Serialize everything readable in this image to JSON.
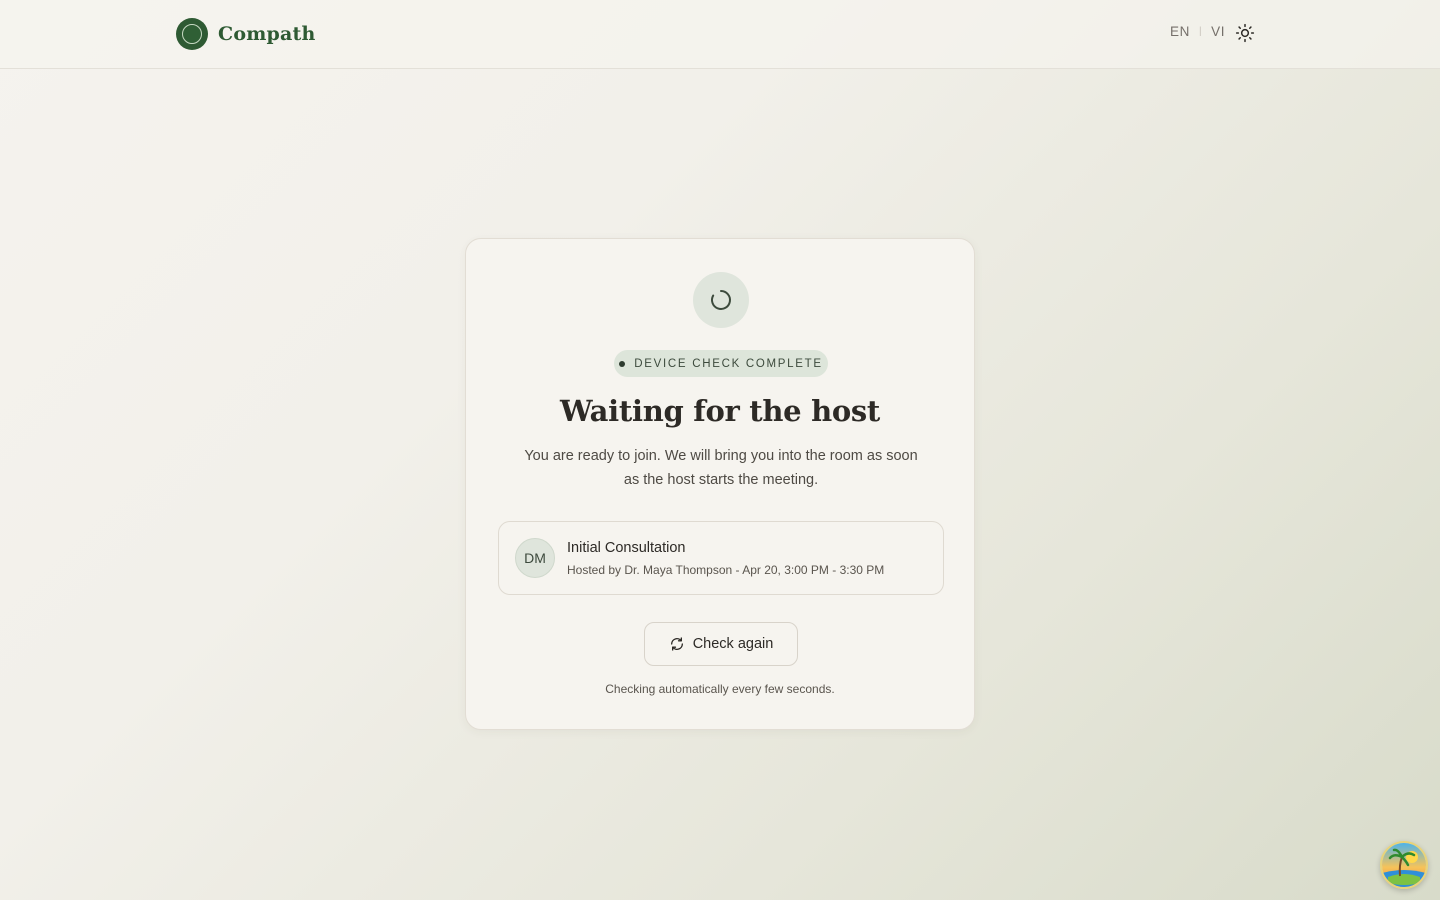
{
  "header": {
    "brand_name": "Compath",
    "languages": [
      "EN",
      "VI"
    ],
    "language_separator": "|",
    "theme_icon": "sun-icon"
  },
  "waiting": {
    "spinner_icon": "loading-spinner-icon",
    "status_badge": "DEVICE CHECK COMPLETE",
    "title": "Waiting for the host",
    "description": "You are ready to join. We will bring you into the room as soon as the host starts the meeting."
  },
  "session": {
    "avatar_initials": "DM",
    "title": "Initial Consultation",
    "meta": "Hosted by Dr. Maya Thompson - Apr 20, 3:00 PM - 3:30 PM"
  },
  "actions": {
    "check_again_label": "Check again",
    "check_again_icon": "refresh-icon",
    "auto_check_note": "Checking automatically every few seconds."
  },
  "assistant": {
    "icon": "tropical-island-icon"
  },
  "colors": {
    "brand": "#2e5a33",
    "badge_bg": "#dde5da",
    "card_bg": "#f6f4ef",
    "page_bg": "#f3f1ec"
  }
}
